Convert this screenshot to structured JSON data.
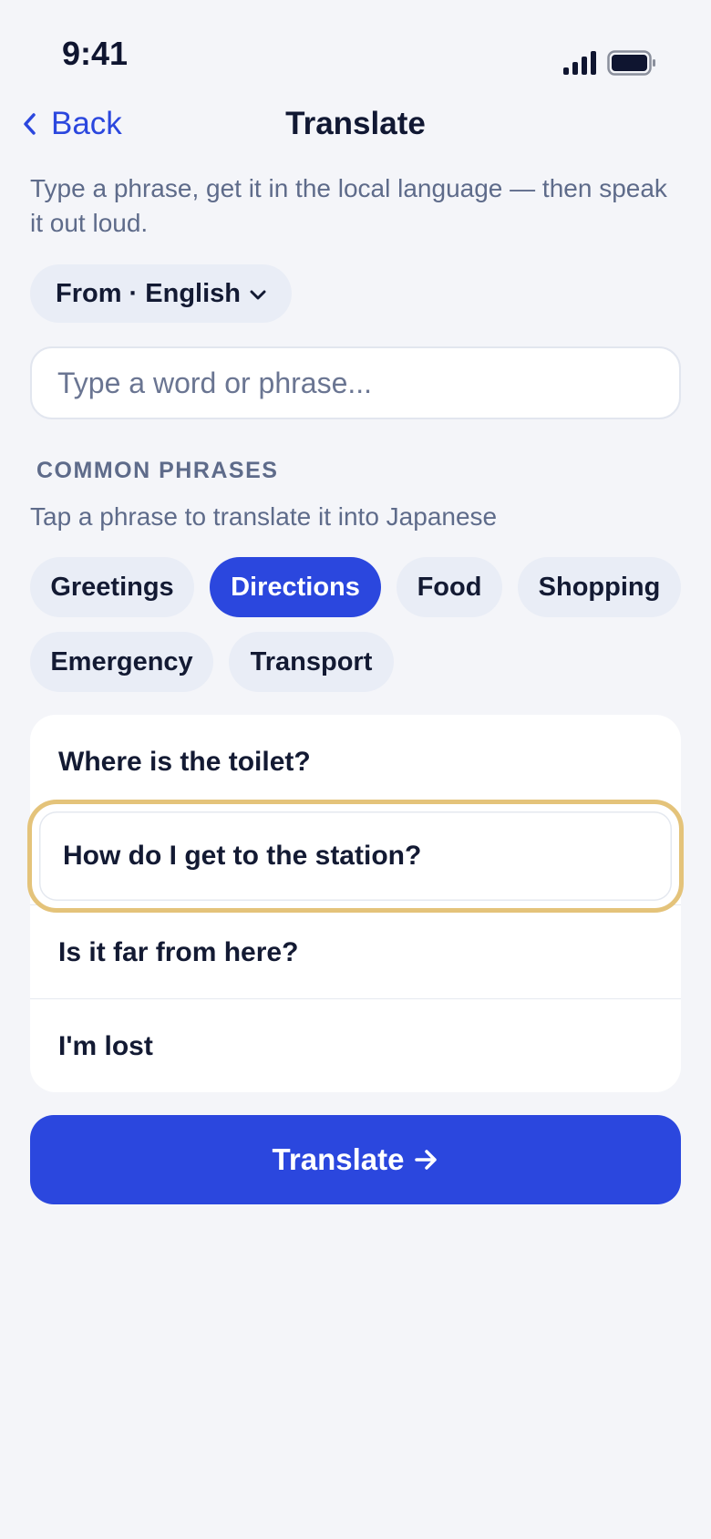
{
  "status_bar": {
    "time": "9:41",
    "icons": [
      "cellular-signal-icon",
      "battery-icon"
    ]
  },
  "nav": {
    "back_label": "Back",
    "title": "Translate"
  },
  "subtitle": "Type a phrase, get it in the local language — then speak it out loud.",
  "from_selector": {
    "label": "From · English"
  },
  "input": {
    "placeholder": "Type a word or phrase...",
    "value": ""
  },
  "common_phrases": {
    "section_label": "COMMON PHRASES",
    "hint": "Tap a phrase to translate it into Japanese",
    "categories": [
      {
        "label": "Greetings",
        "selected": false
      },
      {
        "label": "Directions",
        "selected": true
      },
      {
        "label": "Food",
        "selected": false
      },
      {
        "label": "Shopping",
        "selected": false
      },
      {
        "label": "Emergency",
        "selected": false
      },
      {
        "label": "Transport",
        "selected": false
      }
    ],
    "phrases": [
      {
        "text": "Where is the toilet?",
        "highlighted": false
      },
      {
        "text": "How do I get to the station?",
        "highlighted": true
      },
      {
        "text": "Is it far from here?",
        "highlighted": false
      },
      {
        "text": "I'm lost",
        "highlighted": false
      }
    ]
  },
  "translate_button": {
    "label": "Translate"
  },
  "colors": {
    "accent": "#2b47de",
    "background": "#f4f5f9",
    "chip_background": "#e9edf6",
    "highlight_border": "#e4c37a",
    "muted_text": "#5e6b8a"
  }
}
